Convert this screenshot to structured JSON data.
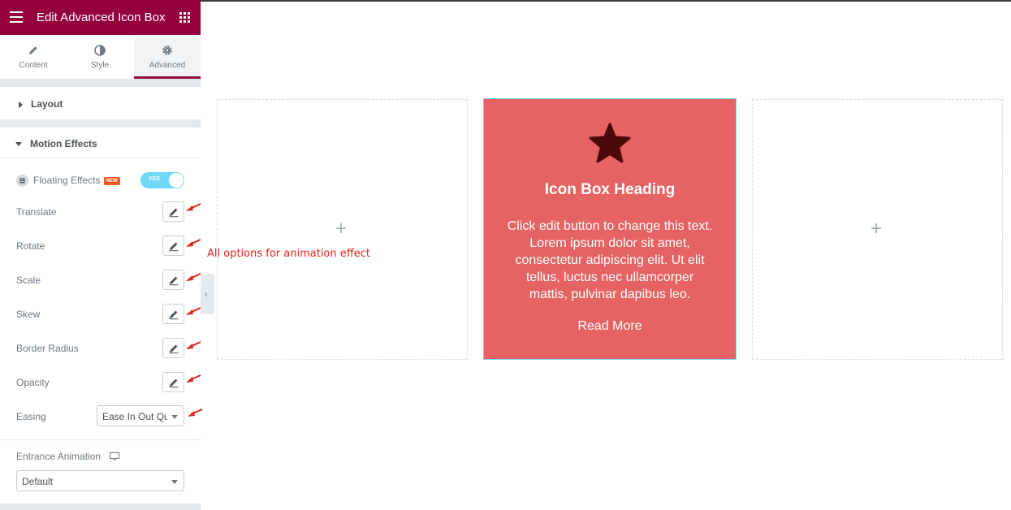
{
  "header": {
    "title": "Edit Advanced Icon Box"
  },
  "tabs": [
    {
      "label": "Content",
      "icon": "pencil-icon"
    },
    {
      "label": "Style",
      "icon": "contrast-icon"
    },
    {
      "label": "Advanced",
      "icon": "gear-icon"
    }
  ],
  "layout_section": {
    "title": "Layout"
  },
  "motion_section": {
    "title": "Motion Effects",
    "floating_label": "Floating Effects",
    "new_badge": "NEW",
    "toggle_text": "YES",
    "rows": [
      "Translate",
      "Rotate",
      "Scale",
      "Skew",
      "Border Radius",
      "Opacity"
    ],
    "easing_label": "Easing",
    "easing_value": "Ease In Out Quad"
  },
  "entrance": {
    "label": "Entrance Animation",
    "value": "Default"
  },
  "annotation": "All options for animation effect",
  "canvas": {
    "plus": "+",
    "iconbox": {
      "heading": "Icon Box Heading",
      "text": "Click edit button to change this text. Lorem ipsum dolor sit amet, consectetur adipiscing elit. Ut elit tellus, luctus nec ullamcorper mattis, pulvinar dapibus leo.",
      "read_more": "Read More",
      "icon": "star-icon"
    }
  },
  "colors": {
    "brand": "#93003c",
    "iconbox_bg": "#e56363",
    "toggle": "#71d7f7",
    "annotation": "#e2231a"
  }
}
